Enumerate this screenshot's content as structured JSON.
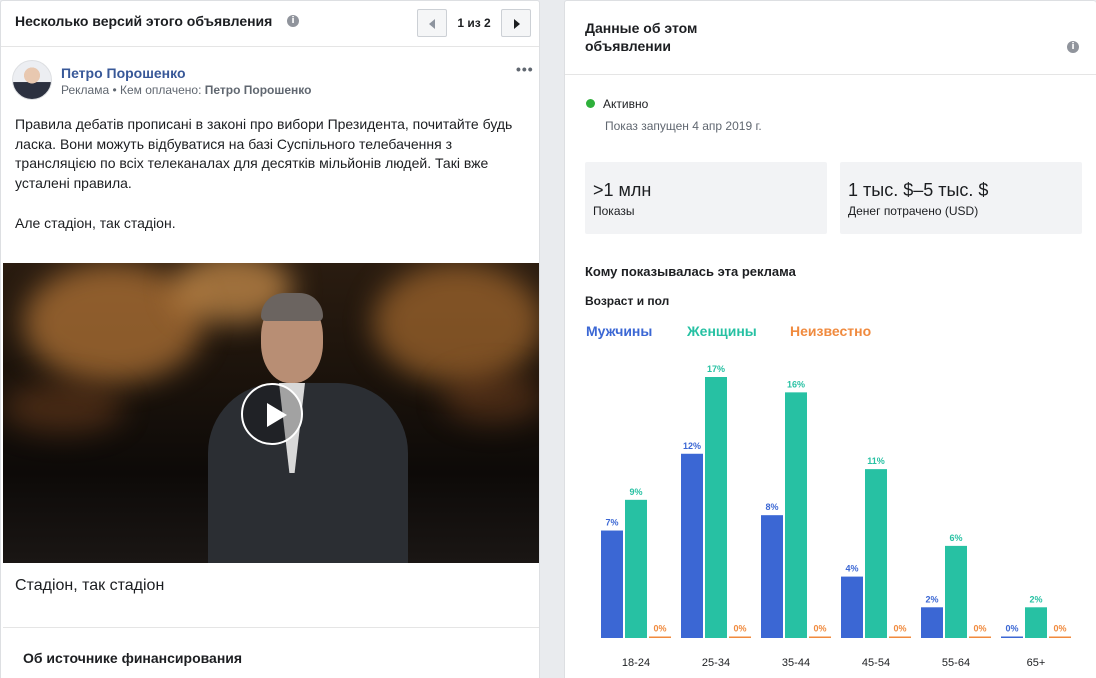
{
  "left": {
    "header_title": "Несколько версий этого объявления",
    "info_icon": "info-icon",
    "pager_text": "1 из 2",
    "post": {
      "author": "Петро Порошенко",
      "meta_prefix": "Реклама • Кем оплачено: ",
      "paid_by": "Петро Порошенко",
      "more": "•••",
      "body": "Правила дебатів прописані в законі про вибори Президента, почитайте будь ласка. Вони можуть відбуватися на базі Суспільного телебачення з трансляцією по всіх телеканалах для десятків мільйонів людей. Такі вже усталені правила.",
      "body2": "Але стадіон, так стадіон.",
      "caption": "Стадіон, так стадіон"
    },
    "funding_title": "Об источнике финансирования"
  },
  "right": {
    "title": "Данные об этом объявлении",
    "status": "Активно",
    "started": "Показ запущен 4 апр 2019 г.",
    "stats": [
      {
        "value": ">1 млн",
        "label": "Показы"
      },
      {
        "value": "1 тыс. $–5 тыс. $",
        "label": "Денег потрачено (USD)"
      }
    ],
    "shown_title": "Кому показывалась эта реклама",
    "age_gender": "Возраст и пол"
  },
  "colors": {
    "men": "#3b67d4",
    "women": "#27c1a3",
    "unknown": "#f08a3e",
    "active": "#2eb03b",
    "link": "#385898"
  },
  "chart_data": {
    "type": "bar",
    "categories": [
      "18-24",
      "25-34",
      "35-44",
      "45-54",
      "55-64",
      "65+"
    ],
    "series": [
      {
        "name": "Мужчины",
        "values": [
          7,
          12,
          8,
          4,
          2,
          0
        ],
        "labels": [
          "7%",
          "12%",
          "8%",
          "4%",
          "2%",
          "0%"
        ]
      },
      {
        "name": "Женщины",
        "values": [
          9,
          17,
          16,
          11,
          6,
          2
        ],
        "labels": [
          "9%",
          "17%",
          "16%",
          "11%",
          "6%",
          "2%"
        ]
      },
      {
        "name": "Неизвестно",
        "values": [
          0,
          0,
          0,
          0,
          0,
          0
        ],
        "labels": [
          "0%",
          "0%",
          "0%",
          "0%",
          "0%",
          "0%"
        ]
      }
    ],
    "ylim": [
      0,
      17
    ],
    "legend": "top-left"
  }
}
